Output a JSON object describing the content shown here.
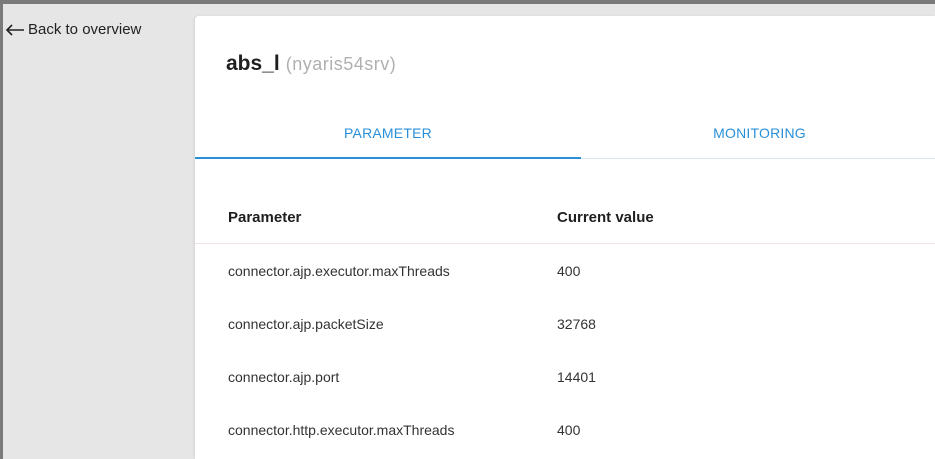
{
  "nav": {
    "back_label": "Back to overview"
  },
  "header": {
    "server_name": "abs_l",
    "host_name": "(nyaris54srv)"
  },
  "tabs": [
    {
      "label": "PARAMETER",
      "active": true
    },
    {
      "label": "MONITORING",
      "active": false
    }
  ],
  "table": {
    "columns": [
      "Parameter",
      "Current value"
    ],
    "rows": [
      {
        "parameter": "connector.ajp.executor.maxThreads",
        "value": "400"
      },
      {
        "parameter": "connector.ajp.packetSize",
        "value": "32768"
      },
      {
        "parameter": "connector.ajp.port",
        "value": "14401"
      },
      {
        "parameter": "connector.http.executor.maxThreads",
        "value": "400"
      }
    ]
  },
  "colors": {
    "accent": "#2a8fd8",
    "rail": "#e6e6e6",
    "panel": "#ffffff"
  }
}
